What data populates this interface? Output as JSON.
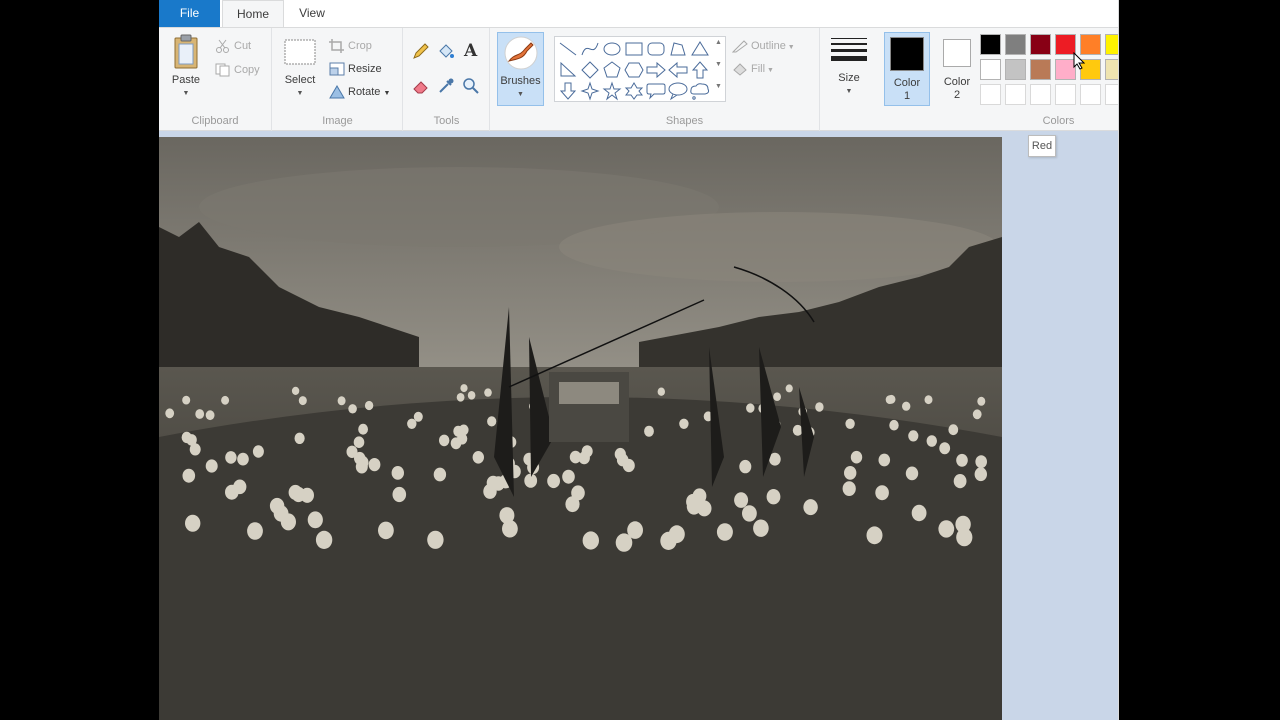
{
  "tabs": {
    "file": "File",
    "home": "Home",
    "view": "View"
  },
  "clipboard": {
    "paste": "Paste",
    "cut": "Cut",
    "copy": "Copy",
    "label": "Clipboard"
  },
  "image": {
    "select": "Select",
    "crop": "Crop",
    "resize": "Resize",
    "rotate": "Rotate",
    "label": "Image"
  },
  "tools": {
    "label": "Tools"
  },
  "brushes": {
    "label": "Brushes"
  },
  "shapes": {
    "outline": "Outline",
    "fill": "Fill",
    "label": "Shapes"
  },
  "size": {
    "label": "Size"
  },
  "colors": {
    "color1_line1": "Color",
    "color1_line2": "1",
    "color2_line1": "Color",
    "color2_line2": "2",
    "label": "Colors",
    "color1_value": "#000000",
    "color2_value": "#ffffff",
    "palette_row1": [
      "#000000",
      "#7f7f7f",
      "#880015",
      "#ed1c24",
      "#ff7f27",
      "#fff200"
    ],
    "palette_row2": [
      "#ffffff",
      "#c3c3c3",
      "#b97a57",
      "#ffaec9",
      "#ffc90e",
      "#efe4b0"
    ],
    "palette_row3": [
      "#ffffff",
      "#ffffff",
      "#ffffff",
      "#ffffff",
      "#ffffff",
      "#ffffff"
    ]
  },
  "tooltip": "Red",
  "accent_color": "#1979ca"
}
